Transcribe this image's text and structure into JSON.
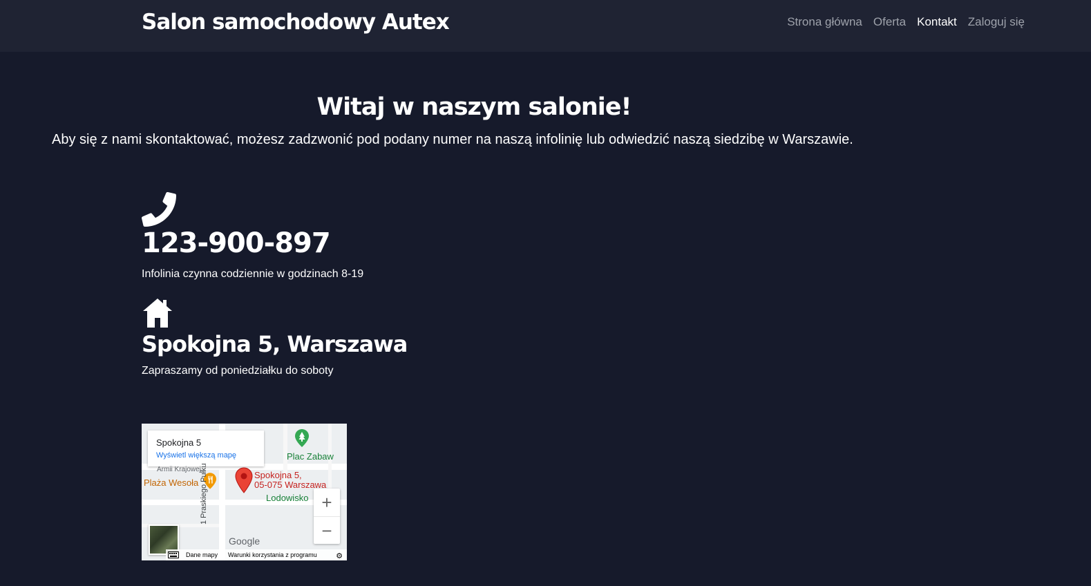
{
  "header": {
    "brand": "Salon samochodowy Autex",
    "nav": [
      {
        "label": "Strona główna",
        "active": false
      },
      {
        "label": "Oferta",
        "active": false
      },
      {
        "label": "Kontakt",
        "active": true
      },
      {
        "label": "Zaloguj się",
        "active": false
      }
    ]
  },
  "hero": {
    "title": "Witaj w naszym salonie!",
    "subtitle": "Aby się z nami skontaktować, możesz zadzwonić pod podany numer na naszą infolinię lub odwiedzić naszą siedzibę w Warszawie."
  },
  "contact": {
    "phone_icon": "phone-icon",
    "phone": "123-900-897",
    "phone_note": "Infolinia czynna codziennie w godzinach 8-19",
    "home_icon": "home-icon",
    "address": "Spokojna 5, Warszawa",
    "address_note": "Zapraszamy od poniedziałku do soboty"
  },
  "map": {
    "card_title": "Spokojna 5",
    "card_link": "Wyświetl większą mapę",
    "pin_label_line1": "Spokojna 5,",
    "pin_label_line2": "05-075 Warszawa",
    "poi_plac": "Plac Zabaw",
    "poi_plaza": "Plaża Wesoła",
    "poi_lodowisko": "Lodowisko",
    "street_armii": "Armii Krajowej",
    "street_praskiego": "1 Praskiego Pułku",
    "zoom_in": "+",
    "zoom_out": "−",
    "google": "Google",
    "attr_data": "Dane mapy",
    "attr_terms": "Warunki korzystania z programu"
  },
  "colors": {
    "background": "#161a2b",
    "navbar": "#1f2333",
    "nav_inactive": "#9ea2ab",
    "nav_active": "#ffffff"
  }
}
